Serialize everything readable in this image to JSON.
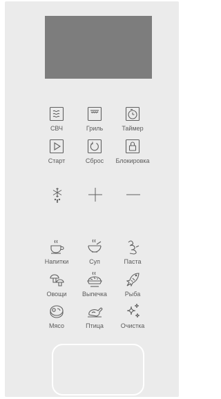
{
  "display": {
    "text": ""
  },
  "mode_buttons": [
    {
      "id": "microwave",
      "label": "СВЧ",
      "icon": "microwave-icon"
    },
    {
      "id": "grill",
      "label": "Гриль",
      "icon": "grill-icon"
    },
    {
      "id": "timer",
      "label": "Таймер",
      "icon": "timer-icon"
    },
    {
      "id": "start",
      "label": "Старт",
      "icon": "play-icon"
    },
    {
      "id": "reset",
      "label": "Сброс",
      "icon": "reset-icon"
    },
    {
      "id": "lock",
      "label": "Блокировка",
      "icon": "lock-icon"
    }
  ],
  "control_symbols": [
    {
      "id": "defrost",
      "icon": "snowflake-icon"
    },
    {
      "id": "plus",
      "icon": "plus-icon"
    },
    {
      "id": "minus",
      "icon": "minus-icon"
    }
  ],
  "food_programs": [
    {
      "id": "drinks",
      "label": "Напитки",
      "icon": "cup-icon"
    },
    {
      "id": "soup",
      "label": "Суп",
      "icon": "soup-icon"
    },
    {
      "id": "pasta",
      "label": "Паста",
      "icon": "pasta-icon"
    },
    {
      "id": "vegetables",
      "label": "Овощи",
      "icon": "mushroom-icon"
    },
    {
      "id": "pastry",
      "label": "Выпечка",
      "icon": "pie-icon"
    },
    {
      "id": "fish",
      "label": "Рыба",
      "icon": "fish-icon"
    },
    {
      "id": "meat",
      "label": "Мясо",
      "icon": "steak-icon"
    },
    {
      "id": "poultry",
      "label": "Птица",
      "icon": "chicken-icon"
    },
    {
      "id": "cleaning",
      "label": "Очистка",
      "icon": "sparkle-icon"
    }
  ],
  "colors": {
    "panel": "#ebebeb",
    "display": "#7d7d7d",
    "icon": "#5f5f5f",
    "label": "#5a5a5a",
    "pad_border": "#ffffff"
  }
}
